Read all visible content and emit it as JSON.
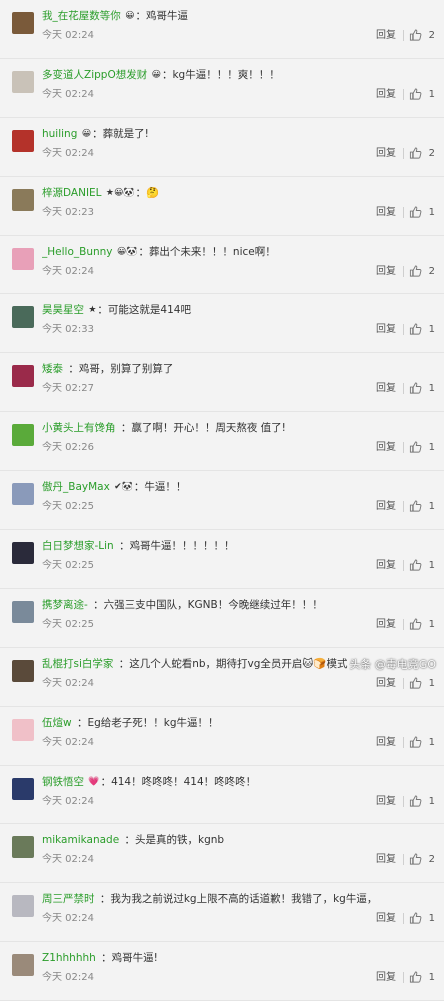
{
  "reply_label": "回复",
  "watermark": "头条 @毒电竞GO",
  "colors": {
    "username": "#2a9d2a",
    "text": "#333333",
    "meta": "#888888",
    "background": "#f3f3f3"
  },
  "comments": [
    {
      "user": "我_在花屋数等你",
      "badges": "😀",
      "text": "鸡哥牛逼",
      "time": "今天 02:24",
      "likes": "2",
      "avatar": "#7a5a3a"
    },
    {
      "user": "多变道人ZippO想发财",
      "badges": "😀",
      "text": "kg牛逼！！！爽！！！",
      "time": "今天 02:24",
      "likes": "1",
      "avatar": "#c9c2b8"
    },
    {
      "user": "huiling",
      "badges": "😀",
      "text": "葬就是了!",
      "time": "今天 02:24",
      "likes": "2",
      "avatar": "#b4322a"
    },
    {
      "user": "梓源DANIEL",
      "badges": "★😀🐼",
      "text": "🤔",
      "time": "今天 02:23",
      "likes": "1",
      "avatar": "#8a7a5a"
    },
    {
      "user": "_Hello_Bunny",
      "badges": "😀🐼",
      "text": "葬出个未来！！！nice啊！",
      "time": "今天 02:24",
      "likes": "2",
      "avatar": "#e8a0b8"
    },
    {
      "user": "昊昊星空",
      "badges": "★",
      "text": "可能这就是414吧",
      "time": "今天 02:33",
      "likes": "1",
      "avatar": "#4a6a5a"
    },
    {
      "user": "矮泰",
      "badges": "",
      "text": "鸡哥，别算了别算了",
      "time": "今天 02:27",
      "likes": "1",
      "avatar": "#9a2a4a"
    },
    {
      "user": "小黄头上有馋角",
      "badges": "",
      "text": "赢了啊！开心！！周天熬夜 值了!",
      "time": "今天 02:26",
      "likes": "1",
      "avatar": "#5aaa3a"
    },
    {
      "user": "傲丹_BayMax",
      "badges": "✔🐼",
      "text": "牛逼！！",
      "time": "今天 02:25",
      "likes": "1",
      "avatar": "#8a9aba"
    },
    {
      "user": "白日梦想家-Lin",
      "badges": "",
      "text": "鸡哥牛逼！！！！！！",
      "time": "今天 02:25",
      "likes": "1",
      "avatar": "#2a2a3a"
    },
    {
      "user": "携梦离途-",
      "badges": "",
      "text": "六强三支中国队，KGNB！今晚继续过年！！！",
      "time": "今天 02:25",
      "likes": "1",
      "avatar": "#7a8a9a"
    },
    {
      "user": "乱棍打si白学家",
      "badges": "",
      "text": "这几个人蛇看nb，期待打vg全员开启🐱🍞模式",
      "time": "今天 02:24",
      "likes": "1",
      "avatar": "#5a4a3a"
    },
    {
      "user": "伍煊w",
      "badges": "",
      "text": "Eg给老子死！！kg牛逼！！",
      "time": "今天 02:24",
      "likes": "1",
      "avatar": "#f0c0c8"
    },
    {
      "user": "钢铁悟空",
      "badges": "💗",
      "text": "414！咚咚咚！414！咚咚咚！",
      "time": "今天 02:24",
      "likes": "1",
      "avatar": "#2a3a6a"
    },
    {
      "user": "mikamikanade",
      "badges": "",
      "text": "头是真的铁，kgnb",
      "time": "今天 02:24",
      "likes": "2",
      "avatar": "#6a7a5a"
    },
    {
      "user": "周三严禁时",
      "badges": "",
      "text": "我为我之前说过kg上限不高的话道歉！我错了，kg牛逼，鸡哥牛逼",
      "time": "今天 02:24",
      "likes": "1",
      "avatar": "#b8b8c0"
    },
    {
      "user": "Z1hhhhhh",
      "badges": "",
      "text": "鸡哥牛逼!",
      "time": "今天 02:24",
      "likes": "1",
      "avatar": "#9a8a7a"
    }
  ]
}
